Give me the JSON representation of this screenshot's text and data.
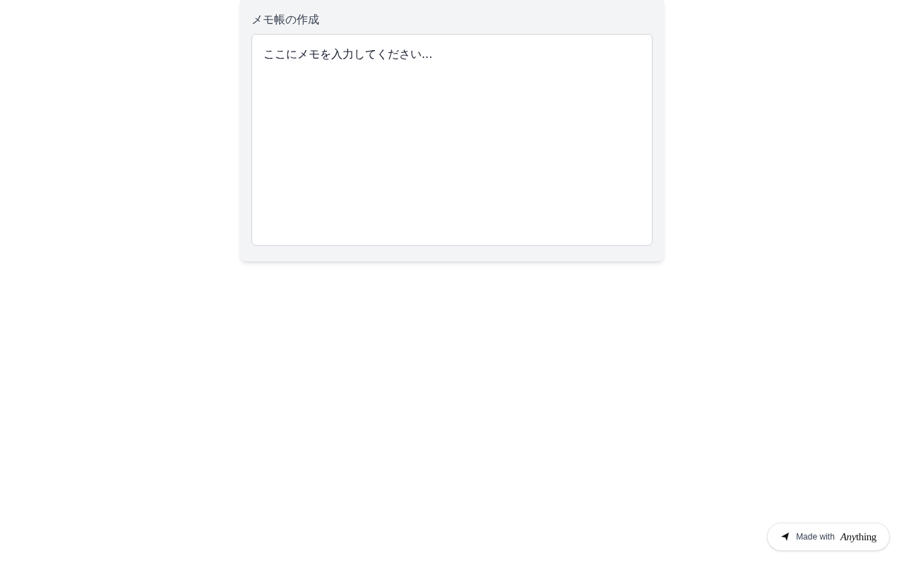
{
  "memo": {
    "title": "メモ帳の作成",
    "placeholder": "ここにメモを入力してください..."
  },
  "badge": {
    "text": "Made with",
    "brand": [
      "Any",
      "thing"
    ]
  }
}
